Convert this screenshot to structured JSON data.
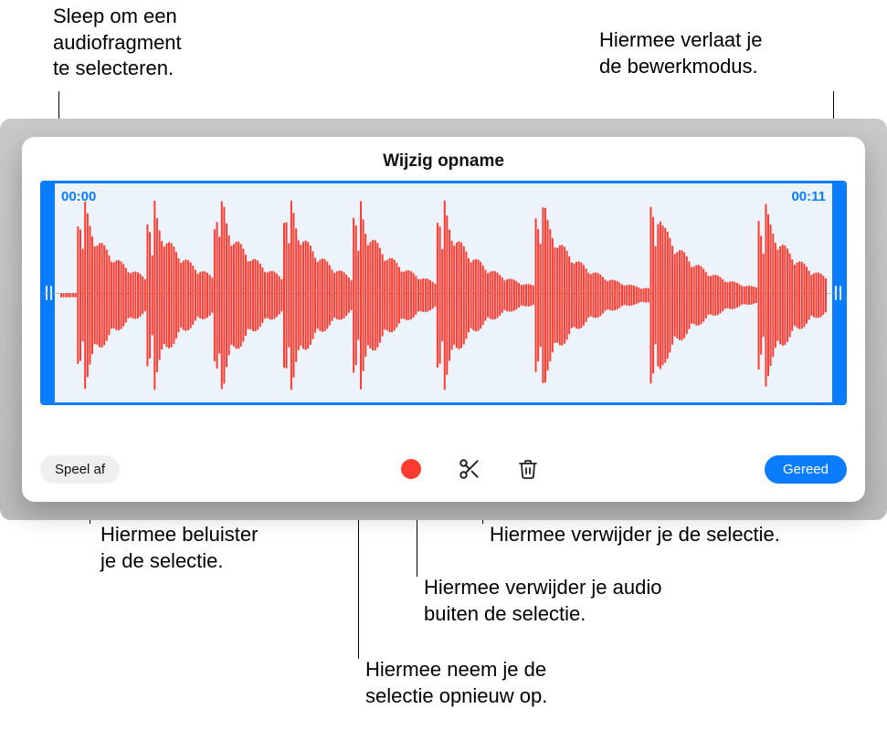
{
  "callouts": {
    "drag_select": "Sleep om een\naudiofragment\nte selecteren.",
    "exit_edit": "Hiermee verlaat je\nde bewerkmodus.",
    "listen_selection": "Hiermee beluister\nje de selectie.",
    "delete_selection": "Hiermee verwijder je de selectie.",
    "trim_outside": "Hiermee verwijder je audio\nbuiten de selectie.",
    "rerecord": "Hiermee neem je de\nselectie opnieuw op."
  },
  "panel": {
    "title": "Wijzig opname",
    "start_time": "00:00",
    "end_time": "00:11",
    "play_label": "Speel af",
    "done_label": "Gereed"
  },
  "icons": {
    "record": "record-icon",
    "scissors": "scissors-icon",
    "trash": "trash-icon"
  },
  "colors": {
    "accent": "#0a7cff",
    "waveform": "#ff3b30",
    "selection_bg": "#ecf3fb"
  }
}
